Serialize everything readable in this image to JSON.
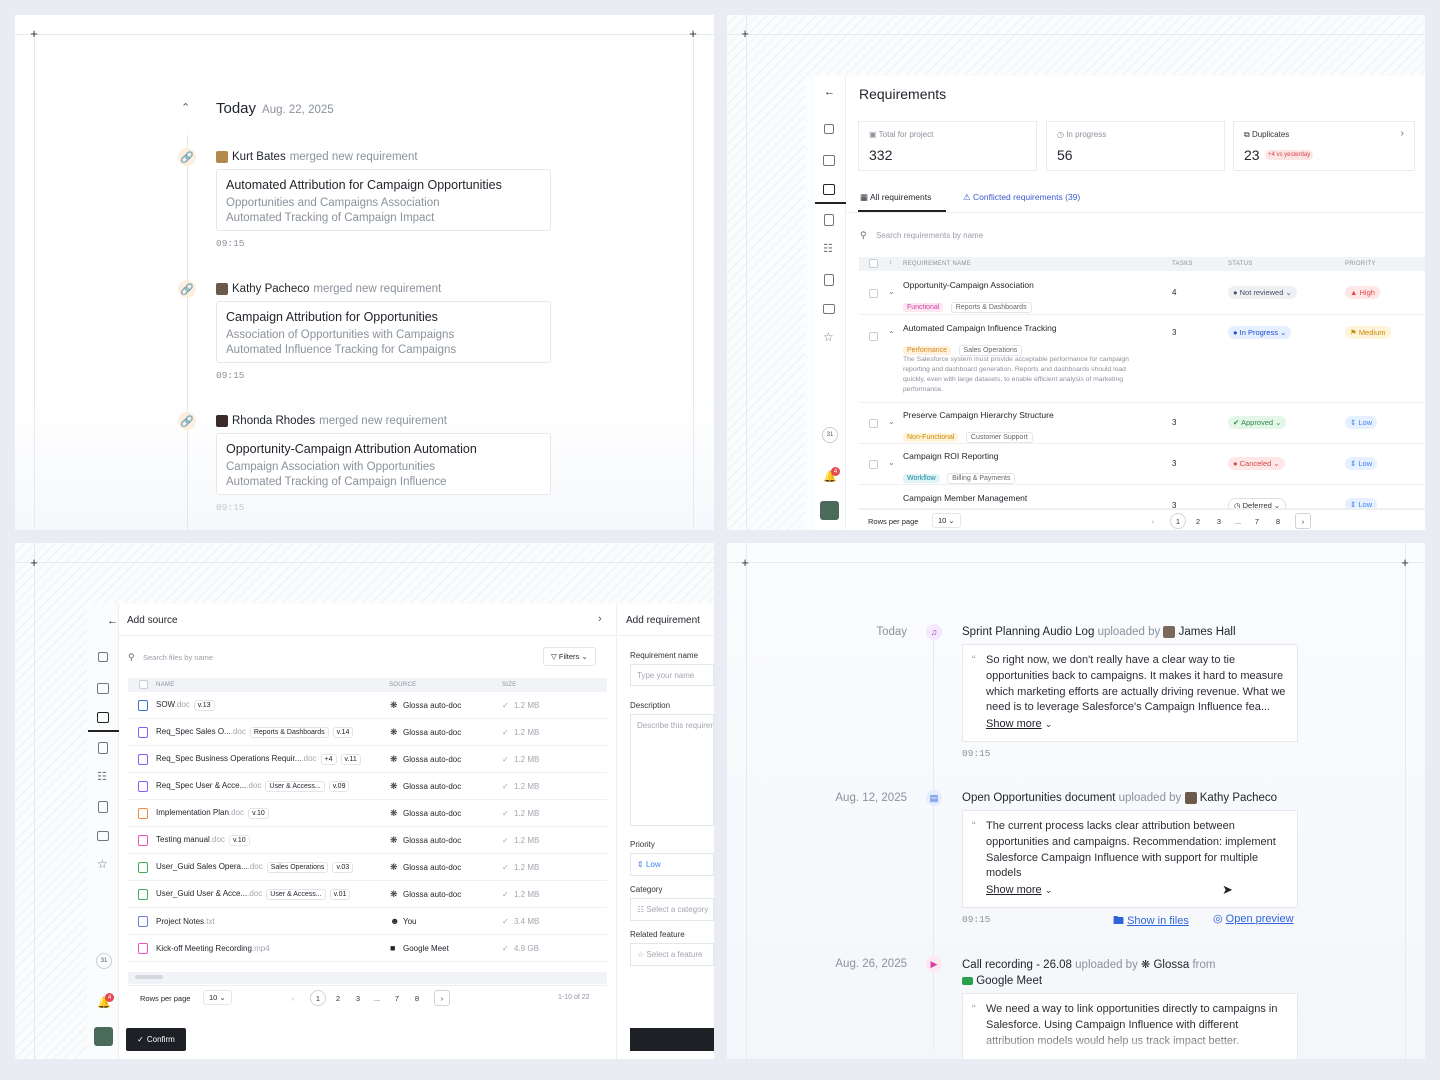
{
  "p1": {
    "header": {
      "title": "Today",
      "date": "Aug. 22, 2025"
    },
    "action_text": "merged new requirement",
    "entries": [
      {
        "user": "Kurt Bates",
        "title": "Automated Attribution for Campaign Opportunities",
        "line1": "Opportunities and Campaigns Association",
        "line2": "Automated Tracking of Campaign Impact",
        "time": "09:15"
      },
      {
        "user": "Kathy Pacheco",
        "title": "Campaign Attribution for Opportunities",
        "line1": "Association of Opportunities with Campaigns",
        "line2": "Automated Influence Tracking for Campaigns",
        "time": "09:15"
      },
      {
        "user": "Rhonda Rhodes",
        "title": "Opportunity-Campaign Attribution Automation",
        "line1": "Campaign Association with Opportunities",
        "line2": "Automated Tracking of Campaign Influence",
        "time": "09:15"
      }
    ]
  },
  "p2": {
    "title": "Requirements",
    "stats": [
      {
        "label": "Total for project",
        "value": "332"
      },
      {
        "label": "In progress",
        "value": "56"
      },
      {
        "label": "Duplicates",
        "value": "23",
        "delta": "+4 vs yesterday"
      }
    ],
    "tabs": [
      "All requirements",
      "Conflicted requirements (39)"
    ],
    "search_placeholder": "Search requirements by name",
    "columns": [
      "REQUIREMENT NAME",
      "TASKS",
      "STATUS",
      "PRIORITY"
    ],
    "rows": [
      {
        "name": "Opportunity-Campaign Association",
        "type": "Functional",
        "area": "Reports & Dashboards",
        "tasks": "4",
        "status": "Not reviewed",
        "priority": "High"
      },
      {
        "name": "Automated Campaign Influence Tracking",
        "type": "Performance",
        "area": "Sales Operations",
        "desc": "The Salesforce system must provide acceptable performance for campaign reporting and dashboard generation. Reports and dashboards should load quickly, even with large datasets, to enable efficient analysis of marketing performance.",
        "tasks": "3",
        "status": "In Progress",
        "priority": "Medium"
      },
      {
        "name": "Preserve Campaign Hierarchy Structure",
        "type": "Non-Functional",
        "area": "Customer Support",
        "tasks": "3",
        "status": "Approved",
        "priority": "Low"
      },
      {
        "name": "Campaign ROI Reporting",
        "type": "Workflow",
        "area": "Billing & Payments",
        "tasks": "3",
        "status": "Canceled",
        "priority": "Low"
      },
      {
        "name": "Campaign Member Management",
        "tasks": "3",
        "status": "Deferred",
        "priority": "Low"
      }
    ],
    "footer": {
      "rows_label": "Rows per page",
      "rows_value": "10",
      "pages": [
        "1",
        "2",
        "3",
        "...",
        "7",
        "8"
      ]
    },
    "badge_count": "4",
    "calendar_day": "31",
    "colors": {
      "high": "#e5484d",
      "medium": "#e0a21a",
      "low": "#3b82f6"
    }
  },
  "p3": {
    "title": "Add source",
    "search_placeholder": "Search files by name",
    "filters_label": "Filters",
    "columns": [
      "NAME",
      "SOURCE",
      "SIZE"
    ],
    "files": [
      {
        "name": "SOW",
        "ext": ".doc",
        "tag": "",
        "ver": "v.13",
        "source": "Glossa auto-doc",
        "size": "1.2 MB",
        "color": "#3b6fd9"
      },
      {
        "name": "Req_Spec Sales O...",
        "ext": ".doc",
        "tag": "Reports & Dashboards",
        "ver": "v.14",
        "source": "Glossa auto-doc",
        "size": "1.2 MB",
        "color": "#8b5cf6"
      },
      {
        "name": "Req_Spec Business Operations Requir...",
        "ext": ".doc",
        "tag": "+4",
        "ver": "v.11",
        "source": "Glossa auto-doc",
        "size": "1.2 MB",
        "color": "#8b5cf6"
      },
      {
        "name": "Req_Spec User & Acce...",
        "ext": ".doc",
        "tag": "User & Access...",
        "ver": "v.09",
        "source": "Glossa auto-doc",
        "size": "1.2 MB",
        "color": "#8b5cf6"
      },
      {
        "name": "Implementation Plan",
        "ext": ".doc",
        "tag": "",
        "ver": "v.10",
        "source": "Glossa auto-doc",
        "size": "1.2 MB",
        "color": "#f08a3c"
      },
      {
        "name": "Testing manual",
        "ext": ".doc",
        "tag": "",
        "ver": "v.10",
        "source": "Glossa auto-doc",
        "size": "1.2 MB",
        "color": "#e854b4"
      },
      {
        "name": "User_Guid Sales Opera...",
        "ext": ".doc",
        "tag": "Sales Operations",
        "ver": "v.03",
        "source": "Glossa auto-doc",
        "size": "1.2 MB",
        "color": "#3faa5a"
      },
      {
        "name": "User_Guid User & Acce...",
        "ext": ".doc",
        "tag": "User & Access...",
        "ver": "v.01",
        "source": "Glossa auto-doc",
        "size": "1.2 MB",
        "color": "#3faa5a"
      },
      {
        "name": "Project Notes",
        "ext": ".txt",
        "tag": "",
        "ver": "",
        "source": "You",
        "size": "3.4 MB",
        "color": "#6b7bd6"
      },
      {
        "name": "Kick-off Meeting Recording",
        "ext": ".mp4",
        "tag": "",
        "ver": "",
        "source": "Google Meet",
        "size": "4.9 GB",
        "color": "#e854b4"
      }
    ],
    "footer": {
      "rows_label": "Rows per page",
      "rows_value": "10",
      "pages": [
        "1",
        "2",
        "3",
        "...",
        "7",
        "8"
      ],
      "range": "1-10 of 22"
    },
    "confirm_label": "Confirm",
    "form": {
      "title": "Add requirement",
      "name_label": "Requirement name",
      "name_placeholder": "Type your name",
      "desc_label": "Description",
      "desc_placeholder": "Describe this requirement",
      "priority_label": "Priority",
      "priority_value": "Low",
      "category_label": "Category",
      "category_placeholder": "Select a category",
      "feature_label": "Related feature",
      "feature_placeholder": "Select a feature"
    },
    "badge_count": "4",
    "calendar_day": "31"
  },
  "p4": {
    "uploaded_by": "uploaded by",
    "from": "from",
    "show_more": "Show more",
    "items": [
      {
        "date": "Today",
        "title": "Sprint Planning Audio Log",
        "user": "James Hall",
        "quote": "So right now, we don't really have a clear way to tie opportunities back to campaigns. It makes it hard to measure which marketing efforts are actually driving revenue. What we need is to leverage Salesforce's Campaign Influence fea...",
        "time": "09:15"
      },
      {
        "date": "Aug. 12, 2025",
        "title": "Open Opportunities document",
        "user": "Kathy Pacheco",
        "quote": "The current process lacks clear attribution between opportunities and campaigns. Recommendation: implement Salesforce Campaign Influence with support for multiple models",
        "time": "09:15",
        "show_in_files": "Show in files",
        "open_preview": "Open preview"
      },
      {
        "date": "Aug. 26, 2025",
        "title": "Call recording - 26.08",
        "user": "Glossa",
        "source": "Google Meet",
        "quote": "We need a way to link opportunities directly to campaigns in Salesforce. Using Campaign Influence with different attribution models would help us track impact better."
      }
    ]
  }
}
